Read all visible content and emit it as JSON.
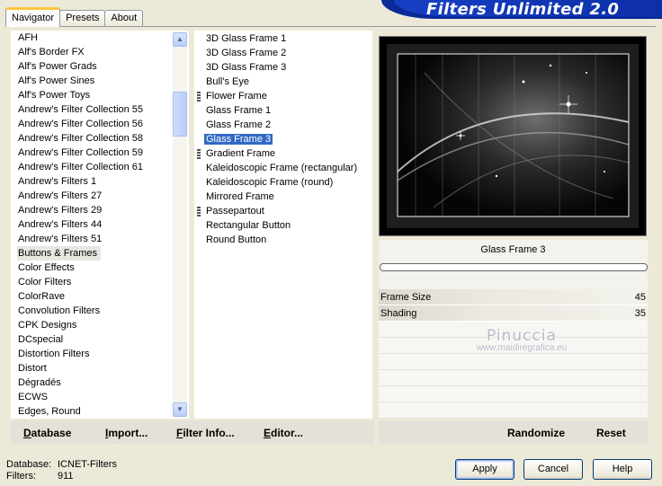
{
  "banner": {
    "title": "Filters Unlimited 2.0"
  },
  "tabs": [
    {
      "label": "Navigator",
      "active": true
    },
    {
      "label": "Presets",
      "active": false
    },
    {
      "label": "About",
      "active": false
    }
  ],
  "categories": {
    "items": [
      "AFH",
      "Alf's Border FX",
      "Alf's Power Grads",
      "Alf's Power Sines",
      "Alf's Power Toys",
      "Andrew's Filter Collection 55",
      "Andrew's Filter Collection 56",
      "Andrew's Filter Collection 58",
      "Andrew's Filter Collection 59",
      "Andrew's Filter Collection 61",
      "Andrew's Filters 1",
      "Andrew's Filters 27",
      "Andrew's Filters 29",
      "Andrew's Filters 44",
      "Andrew's Filters 51",
      "Buttons & Frames",
      "Color Effects",
      "Color Filters",
      "ColorRave",
      "Convolution Filters",
      "CPK Designs",
      "DCspecial",
      "Distortion Filters",
      "Distort",
      "Dégradés",
      "ECWS",
      "Edges, Round"
    ],
    "selected": "Buttons & Frames"
  },
  "effects": {
    "items": [
      {
        "label": "3D Glass Frame 1",
        "marker": false
      },
      {
        "label": "3D Glass Frame 2",
        "marker": false
      },
      {
        "label": "3D Glass Frame 3",
        "marker": false
      },
      {
        "label": "Bull's Eye",
        "marker": false
      },
      {
        "label": "Flower Frame",
        "marker": true
      },
      {
        "label": "Glass Frame 1",
        "marker": false
      },
      {
        "label": "Glass Frame 2",
        "marker": false
      },
      {
        "label": "Glass Frame 3",
        "marker": false
      },
      {
        "label": "Gradient Frame",
        "marker": true
      },
      {
        "label": "Kaleidoscopic Frame (rectangular)",
        "marker": false
      },
      {
        "label": "Kaleidoscopic Frame (round)",
        "marker": false
      },
      {
        "label": "Mirrored Frame",
        "marker": false
      },
      {
        "label": "Passepartout",
        "marker": true
      },
      {
        "label": "Rectangular Button",
        "marker": false
      },
      {
        "label": "Round Button",
        "marker": false
      }
    ],
    "selected": "Glass Frame 3"
  },
  "preview": {
    "effect_name": "Glass Frame 3",
    "progress": 0
  },
  "controls": [
    {
      "label": "Frame Size",
      "value": "45"
    },
    {
      "label": "Shading",
      "value": "35"
    }
  ],
  "watermark": {
    "name": "Pinuccia",
    "site": "www.maidiregrafica.eu"
  },
  "toolbar": {
    "database": "Database",
    "import": "Import...",
    "filter_info": "Filter Info...",
    "editor": "Editor...",
    "randomize": "Randomize",
    "reset": "Reset"
  },
  "footer": {
    "database_label": "Database:",
    "database_value": "ICNET-Filters",
    "filters_label": "Filters:",
    "filters_value": "911",
    "apply": "Apply",
    "cancel": "Cancel",
    "help": "Help"
  }
}
